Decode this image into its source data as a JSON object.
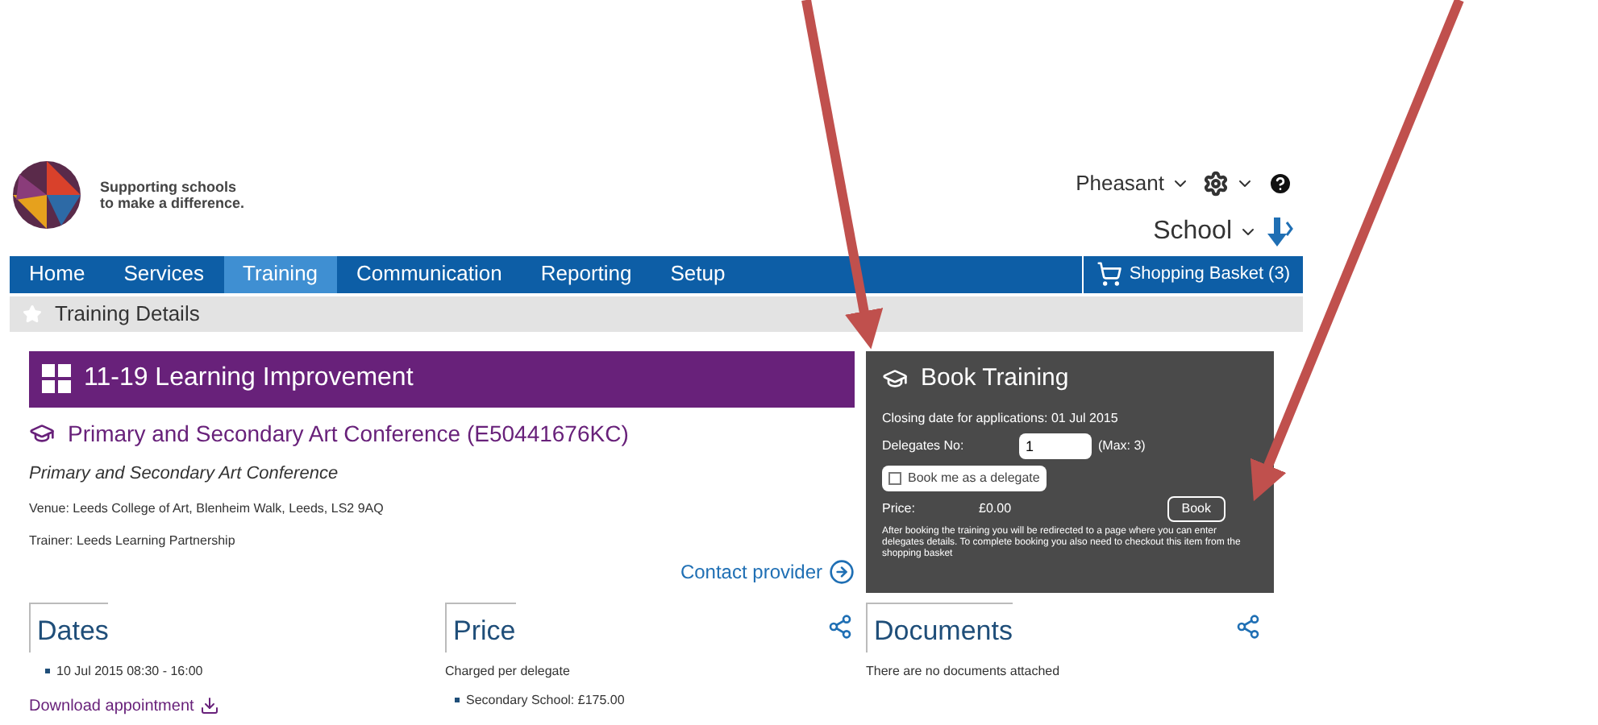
{
  "header": {
    "tagline_1": "Supporting schools",
    "tagline_2": "to make a difference.",
    "user": "Pheasant",
    "school": "School"
  },
  "nav": {
    "items": [
      {
        "label": "Home",
        "selected": false
      },
      {
        "label": "Services",
        "selected": false
      },
      {
        "label": "Training",
        "selected": true
      },
      {
        "label": "Communication",
        "selected": false
      },
      {
        "label": "Reporting",
        "selected": false
      },
      {
        "label": "Setup",
        "selected": false
      }
    ],
    "basket": "Shopping Basket (3)"
  },
  "breadcrumb": "Training Details",
  "course": {
    "category": "11-19 Learning Improvement",
    "title": "Primary and Secondary Art Conference (E50441676KC)",
    "subtitle": "Primary and Secondary Art Conference",
    "venue": "Venue: Leeds College of Art, Blenheim Walk, Leeds, LS2 9AQ",
    "trainer": "Trainer: Leeds Learning Partnership",
    "contact": "Contact provider"
  },
  "booking": {
    "title": "Book Training",
    "closing": "Closing date for applications: 01 Jul 2015",
    "delegates_label": "Delegates No:",
    "delegates_value": "1",
    "max": "(Max: 3)",
    "book_me": {
      "label": "Book me as a delegate",
      "checked": false
    },
    "price_label": "Price:",
    "price": "£0.00",
    "book_button": "Book",
    "note": "After booking the training you will be redirected to a page where you can enter delegates details. To complete booking you also need to checkout this item from the shopping basket"
  },
  "dates": {
    "title": "Dates",
    "items": [
      "10 Jul 2015 08:30 - 16:00"
    ],
    "download": "Download appointment"
  },
  "price_section": {
    "title": "Price",
    "note": "Charged per delegate",
    "items": [
      "Secondary School: £175.00"
    ]
  },
  "documents": {
    "title": "Documents",
    "empty": "There are no documents attached"
  }
}
